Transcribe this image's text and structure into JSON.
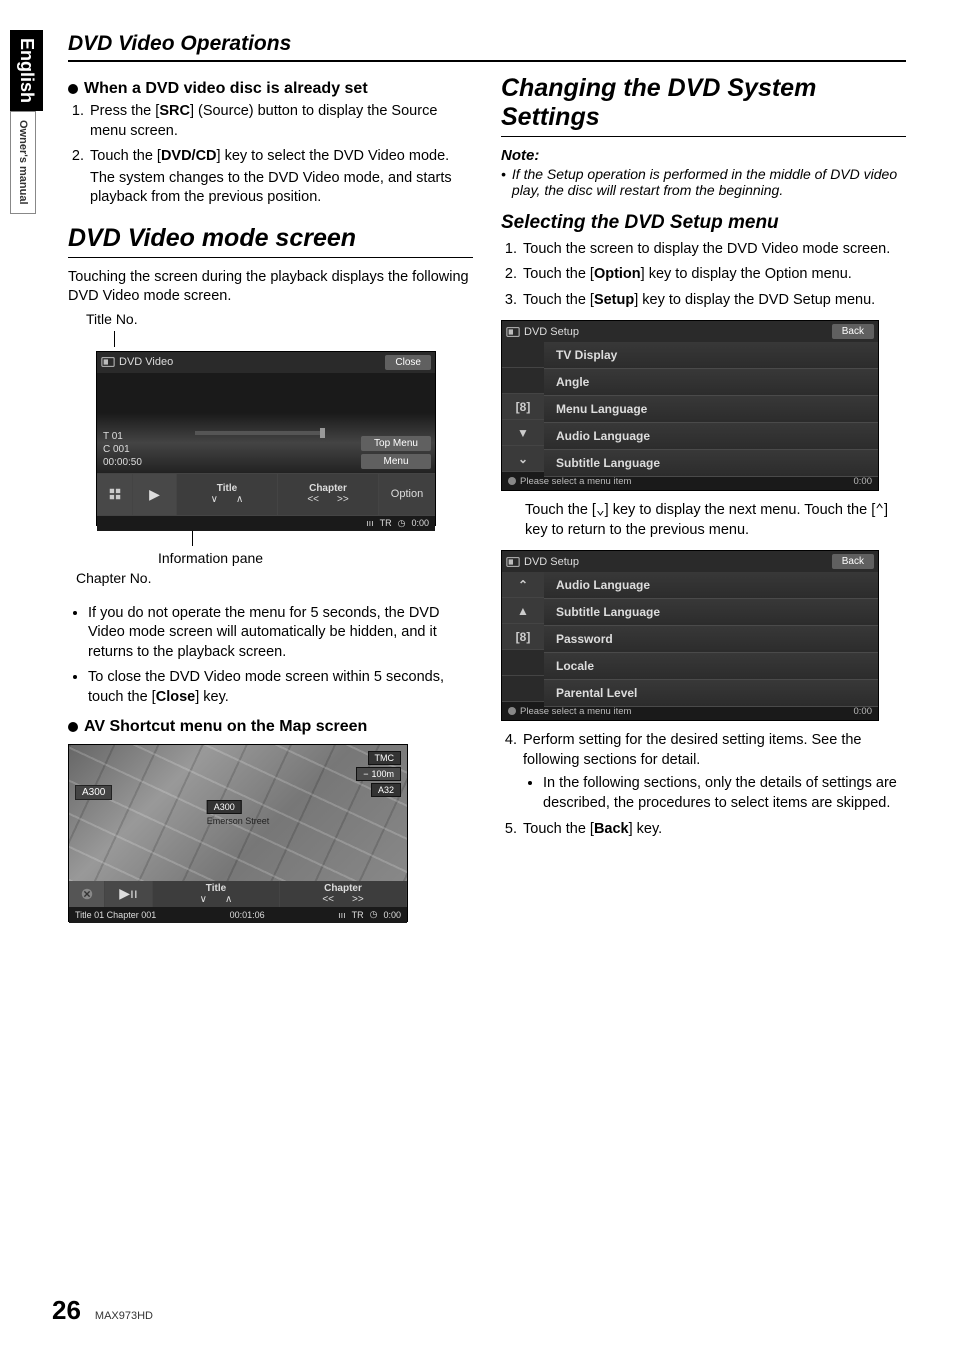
{
  "sideTab": {
    "lang": "English",
    "label": "Owner's manual"
  },
  "pageHeader": "DVD Video Operations",
  "left": {
    "h_whenSet": "When a DVD video disc is already set",
    "step1_a": "Press the [",
    "step1_b": "SRC",
    "step1_c": "] (Source) button to display the Source menu screen.",
    "step2_a": "Touch the [",
    "step2_b": "DVD/CD",
    "step2_c": "] key to select the DVD Video mode.",
    "step2_d": "The system changes to the DVD Video mode, and starts playback from the previous position.",
    "h_modeScreen": "DVD Video mode screen",
    "modeIntro": "Touching the screen during the playback displays the following DVD Video mode screen.",
    "fig_titleNo": "Title No.",
    "fig_infoPane": "Information pane",
    "fig_chapterNo": "Chapter No.",
    "note1": "If you do not operate the menu for 5 seconds, the DVD Video mode screen will automatically be hidden, and it returns to the playback screen.",
    "note2_a": "To close the DVD Video mode screen within 5 seconds, touch the [",
    "note2_b": "Close",
    "note2_c": "] key.",
    "h_avShortcut": "AV Shortcut menu on the Map screen"
  },
  "dvdModeShot": {
    "headerLabel": "DVD Video",
    "close": "Close",
    "t": "T 01",
    "c": "C 001",
    "time": "00:00:50",
    "topMenu": "Top Menu",
    "menu": "Menu",
    "ctrlTitle": "Title",
    "ctrlChapter": "Chapter",
    "option": "Option",
    "statusTR": "TR",
    "statusTime": "0:00"
  },
  "mapShot": {
    "leftBadge": "A300",
    "center": "Emerson Street",
    "centerBadge": "A300",
    "scale": "100m",
    "traffic": "TMC",
    "rightBadge": "A32",
    "ctrlTitle": "Title",
    "ctrlChapter": "Chapter",
    "statusLeft": "Title 01  Chapter 001",
    "statusMid": "00:01:06",
    "statusTR": "TR",
    "statusTime": "0:00"
  },
  "right": {
    "h_changing": "Changing the DVD System Settings",
    "noteHd": "Note:",
    "noteBody": "If the Setup operation is performed in the middle of DVD video play, the disc will restart from the beginning.",
    "h_selecting": "Selecting the DVD Setup menu",
    "s1": "Touch the screen to display the DVD Video mode screen.",
    "s2_a": "Touch the [",
    "s2_b": "Option",
    "s2_c": "] key to display the Option menu.",
    "s3_a": "Touch the [",
    "s3_b": "Setup",
    "s3_c": "] key to display the DVD Setup menu.",
    "afterSetup_a": "Touch the [",
    "afterSetup_b": "] key to display the next menu. Touch the [",
    "afterSetup_c": "] key to return to the previous menu.",
    "s4": "Perform setting for the desired setting items. See the following sections for detail.",
    "s4sub": "In the following sections, only the details of settings are described, the procedures to select items are skipped.",
    "s5_a": "Touch the [",
    "s5_b": "Back",
    "s5_c": "] key."
  },
  "setup1": {
    "header": "DVD Setup",
    "back": "Back",
    "items": [
      "TV Display",
      "Angle",
      "Menu Language",
      "Audio Language",
      "Subtitle Language"
    ],
    "side": [
      "",
      "",
      "[8]",
      "▼",
      "⌄"
    ],
    "footer": "Please select a menu item",
    "footerTime": "0:00"
  },
  "setup2": {
    "header": "DVD Setup",
    "back": "Back",
    "items": [
      "Audio Language",
      "Subtitle Language",
      "Password",
      "Locale",
      "Parental Level"
    ],
    "side": [
      "⌃",
      "▲",
      "[8]",
      "",
      ""
    ],
    "footer": "Please select a menu item",
    "footerTime": "0:00"
  },
  "footer": {
    "pageNum": "26",
    "model": "MAX973HD"
  }
}
